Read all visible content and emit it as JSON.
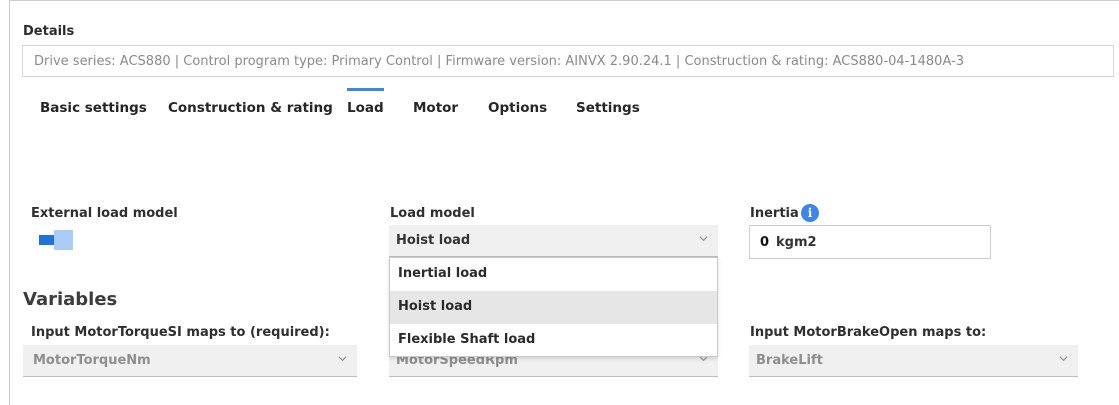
{
  "details": {
    "label": "Details",
    "text": "Drive series: ACS880 | Control program type: Primary Control | Firmware version: AINVX 2.90.24.1 | Construction & rating: ACS880-04-1480A-3"
  },
  "tabs": [
    {
      "label": "Basic settings",
      "active": false
    },
    {
      "label": "Construction & rating",
      "active": false
    },
    {
      "label": "Load",
      "active": true
    },
    {
      "label": "Motor",
      "active": false
    },
    {
      "label": "Options",
      "active": false
    },
    {
      "label": "Settings",
      "active": false
    }
  ],
  "external_load_model": {
    "label": "External load model",
    "enabled": true
  },
  "load_model": {
    "label": "Load model",
    "value": "Hoist load",
    "options": [
      "Inertial load",
      "Hoist load",
      "Flexible Shaft load"
    ]
  },
  "inertia": {
    "label": "Inertia",
    "value": "0",
    "unit": "kgm2",
    "info_icon": "info-icon"
  },
  "variables": {
    "title": "Variables",
    "torque": {
      "label": "Input MotorTorqueSI maps to (required):",
      "value": "MotorTorqueNm"
    },
    "speed": {
      "value": "MotorSpeedRpm"
    },
    "brake": {
      "label": "Input MotorBrakeOpen maps to:",
      "value": "BrakeLift"
    }
  },
  "colors": {
    "accent": "#3b86e8",
    "toggle_on": "#1f73db"
  }
}
